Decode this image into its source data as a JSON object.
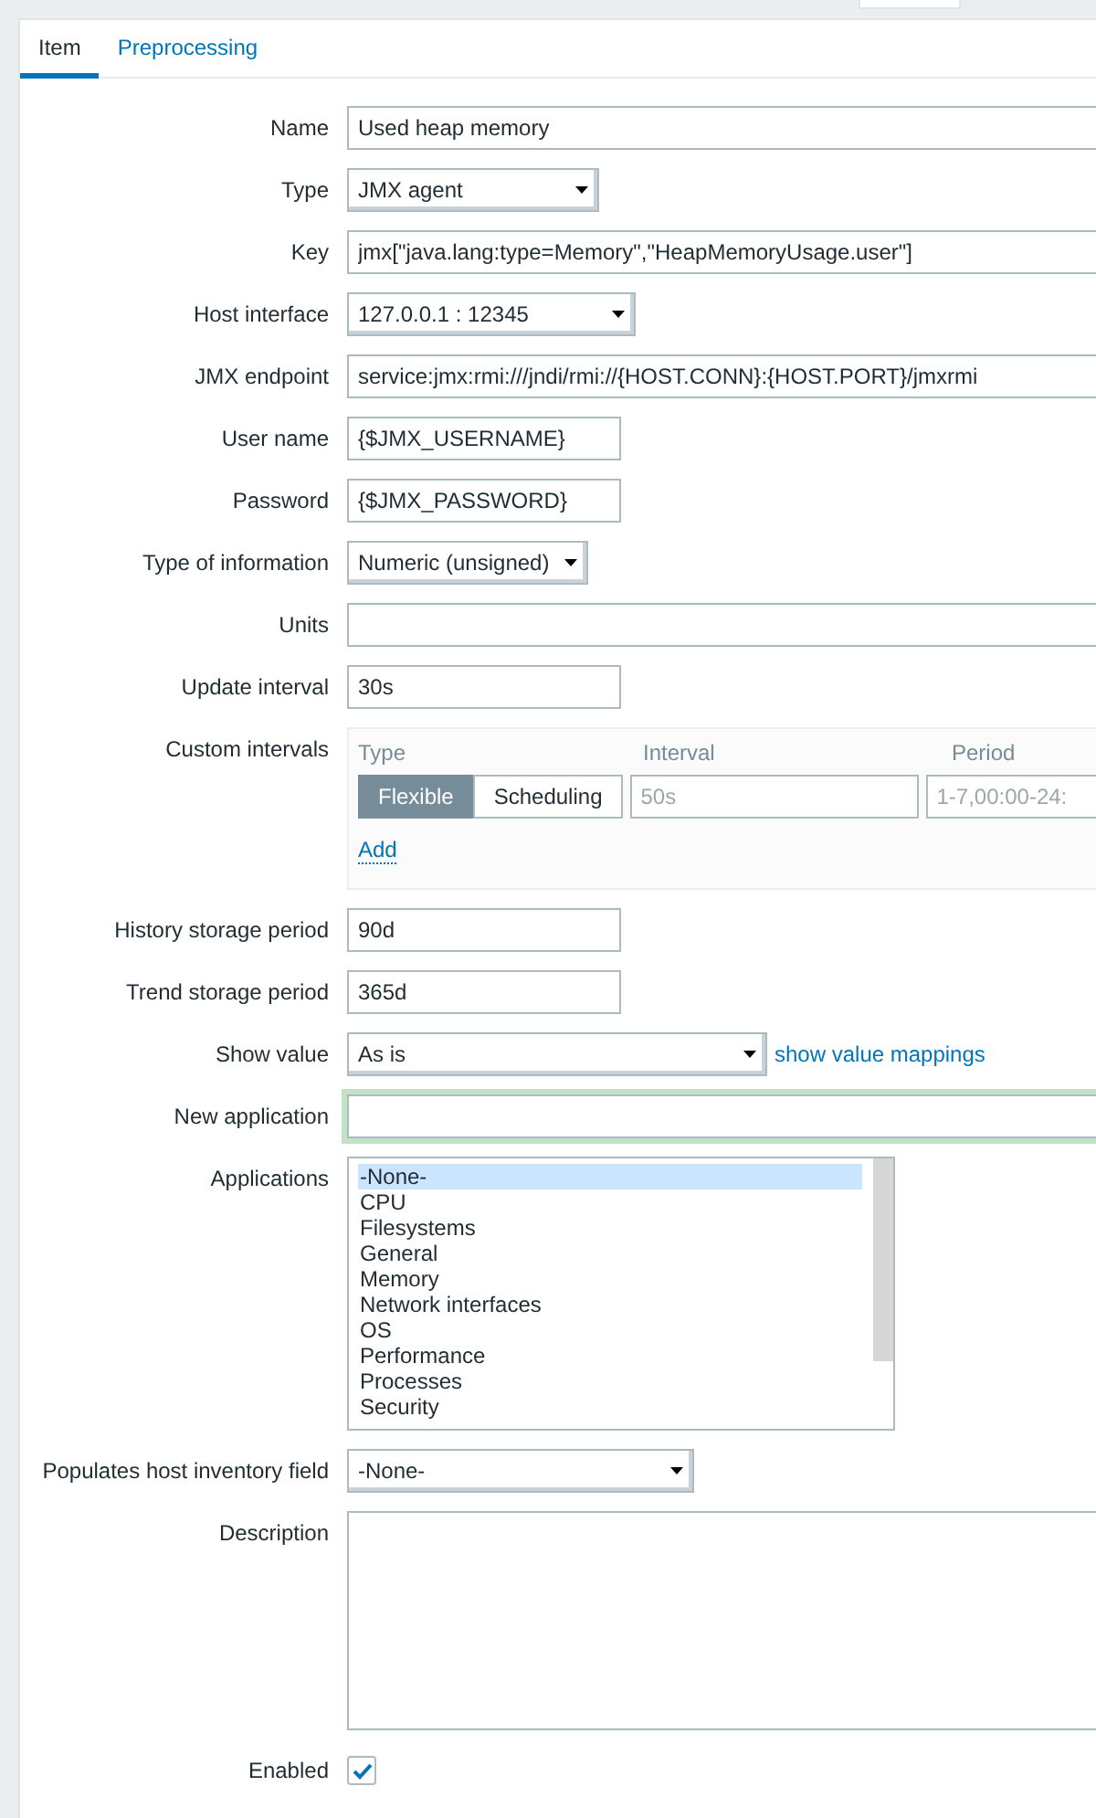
{
  "tabs": [
    {
      "label": "Item",
      "selected": true
    },
    {
      "label": "Preprocessing",
      "selected": false
    }
  ],
  "form": [
    {
      "kind": "text",
      "label": "Name",
      "value": "Used heap memory"
    },
    {
      "kind": "select",
      "label": "Type",
      "value": "JMX agent"
    },
    {
      "kind": "text",
      "label": "Key",
      "value": "jmx[\"java.lang:type=Memory\",\"HeapMemoryUsage.user\"]"
    },
    {
      "kind": "select",
      "label": "Host interface",
      "value": "127.0.0.1 : 12345"
    },
    {
      "kind": "text",
      "label": "JMX endpoint",
      "value": "service:jmx:rmi:///jndi/rmi://{HOST.CONN}:{HOST.PORT}/jmxrmi"
    },
    {
      "kind": "text",
      "label": "User name",
      "value": "{$JMX_USERNAME}"
    },
    {
      "kind": "text",
      "label": "Password",
      "value": "{$JMX_PASSWORD}"
    },
    {
      "kind": "select",
      "label": "Type of information",
      "value": "Numeric (unsigned)"
    },
    {
      "kind": "text",
      "label": "Units"
    },
    {
      "kind": "text",
      "label": "Update interval",
      "value": "30s"
    },
    {
      "kind": "intervals",
      "label": "Custom intervals",
      "headers": [
        "Type",
        "Interval",
        "Period"
      ],
      "types": [
        {
          "label": "Flexible",
          "selected": true
        },
        {
          "label": "Scheduling",
          "selected": false
        }
      ],
      "interval_placeholder": "50s",
      "period_placeholder": "1-7,00:00-24:",
      "add": "Add"
    },
    {
      "kind": "text",
      "label": "History storage period",
      "value": "90d"
    },
    {
      "kind": "text",
      "label": "Trend storage period",
      "value": "365d"
    },
    {
      "kind": "select",
      "label": "Show value",
      "value": "As is",
      "link": "show value mappings"
    },
    {
      "kind": "text",
      "label": "New application",
      "focused": true
    },
    {
      "kind": "listbox",
      "label": "Applications",
      "items": [
        {
          "label": "-None-",
          "selected": true
        },
        {
          "label": "CPU",
          "selected": false
        },
        {
          "label": "Filesystems",
          "selected": false
        },
        {
          "label": "General",
          "selected": false
        },
        {
          "label": "Memory",
          "selected": false
        },
        {
          "label": "Network interfaces",
          "selected": false
        },
        {
          "label": "OS",
          "selected": false
        },
        {
          "label": "Performance",
          "selected": false
        },
        {
          "label": "Processes",
          "selected": false
        },
        {
          "label": "Security",
          "selected": false
        }
      ]
    },
    {
      "kind": "select",
      "label": "Populates host inventory field",
      "value": "-None-"
    },
    {
      "kind": "textarea",
      "label": "Description"
    },
    {
      "kind": "checkbox",
      "label": "Enabled",
      "checked": true
    }
  ]
}
